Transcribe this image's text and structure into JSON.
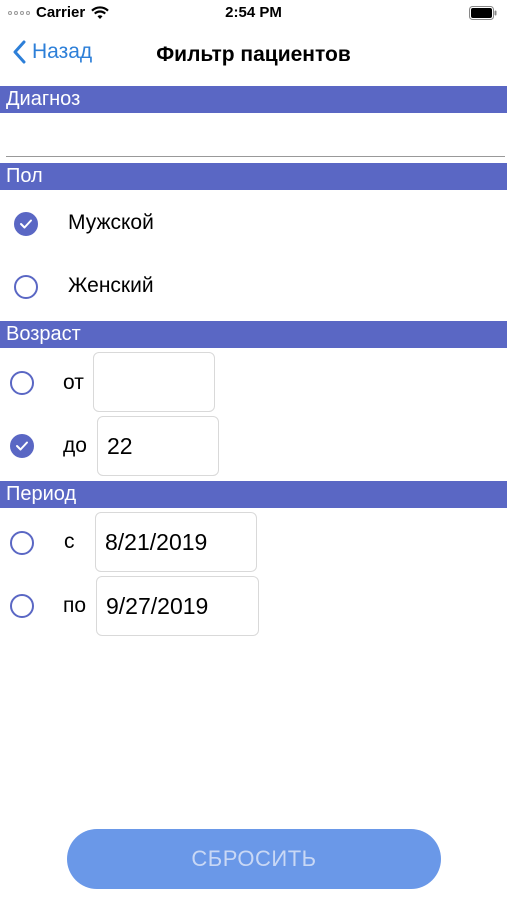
{
  "status": {
    "carrier": "Carrier",
    "time": "2:54 PM"
  },
  "nav": {
    "back_label": "Назад",
    "title": "Фильтр пациентов"
  },
  "sections": {
    "diagnosis": "Диагноз",
    "sex": "Пол",
    "age": "Возраст",
    "period": "Период"
  },
  "diagnosis": {
    "value": ""
  },
  "sex": {
    "options": [
      {
        "label": "Мужской",
        "selected": true
      },
      {
        "label": "Женский",
        "selected": false
      }
    ]
  },
  "age": {
    "from_label": "от",
    "from_value": "",
    "from_selected": false,
    "to_label": "до",
    "to_value": "22",
    "to_selected": true
  },
  "period": {
    "from_label": "с",
    "from_value": "8/21/2019",
    "from_selected": false,
    "to_label": "по",
    "to_value": "9/27/2019",
    "to_selected": false
  },
  "reset_label": "СБРОСИТЬ",
  "colors": {
    "accent": "#5a67c4",
    "link": "#2d7fd8",
    "button": "#6a98e8"
  }
}
